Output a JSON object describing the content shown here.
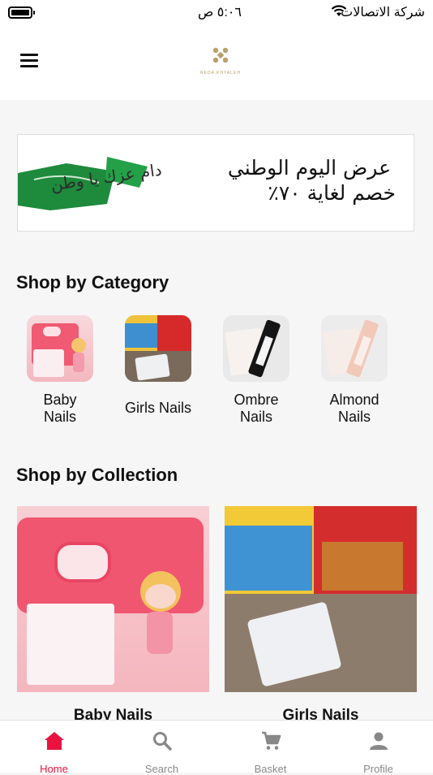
{
  "status_bar": {
    "carrier": "شركة الاتصالات",
    "time": "٥:٠٦ ص"
  },
  "header": {
    "logo_text": "REDA KHYALEH"
  },
  "banner": {
    "line1": "عرض اليوم الوطني",
    "line2": "خصم لغاية ٧٠٪",
    "signature": "دام عزك يا وطن"
  },
  "categories_section": {
    "title": "Shop by Category",
    "items": [
      {
        "label_line1": "Baby",
        "label_line2": "Nails"
      },
      {
        "label_line1": "Girls Nails",
        "label_line2": ""
      },
      {
        "label_line1": "Ombre",
        "label_line2": "Nails"
      },
      {
        "label_line1": "Almond",
        "label_line2": "Nails"
      }
    ]
  },
  "collections_section": {
    "title": "Shop by Collection",
    "items": [
      {
        "label": "Baby Nails"
      },
      {
        "label": "Girls Nails"
      }
    ]
  },
  "bottom_nav": {
    "items": [
      {
        "label": "Home",
        "icon": "home-icon",
        "active": true
      },
      {
        "label": "Search",
        "icon": "search-icon",
        "active": false
      },
      {
        "label": "Basket",
        "icon": "cart-icon",
        "active": false
      },
      {
        "label": "Profile",
        "icon": "person-icon",
        "active": false
      }
    ]
  },
  "colors": {
    "accent": "#e8133e",
    "inactive": "#888888",
    "brand_gold": "#b8a06a"
  }
}
